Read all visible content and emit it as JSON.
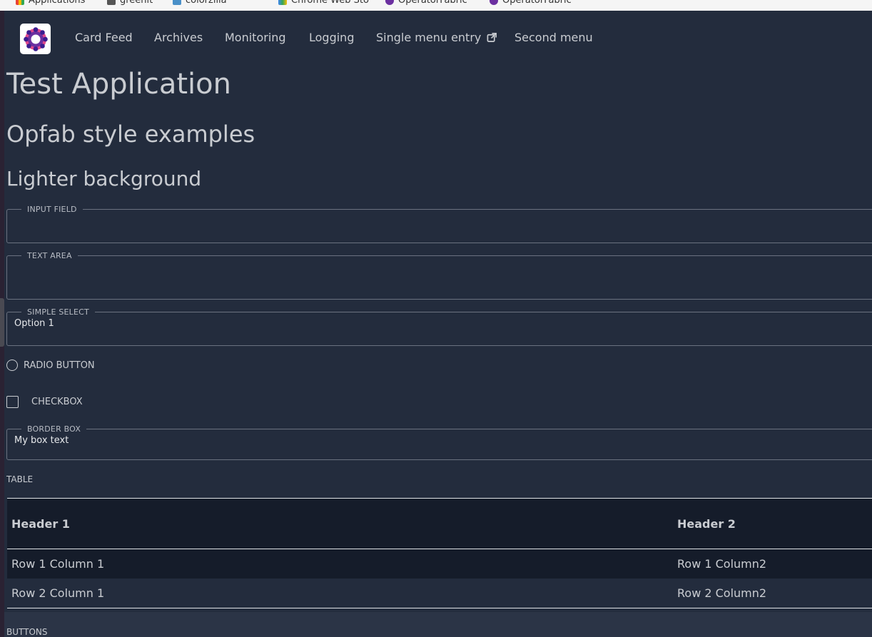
{
  "colors": {
    "background": "#232c3d",
    "table_header_bg": "#151c2a",
    "text": "#c9ccd1",
    "logo_purple": "#6b2fa0"
  },
  "bookmarks_bar": [
    {
      "label": "Applications",
      "icon": "apps-icon"
    },
    {
      "label": "greenit",
      "icon": "folder-icon"
    },
    {
      "label": "colorzilla",
      "icon": "page-icon"
    },
    {
      "label": "Chrome Web Sto",
      "icon": "chrome-store-icon"
    },
    {
      "label": "OperatorFabric",
      "icon": "opfab-favicon"
    },
    {
      "label": "OperatorFabric",
      "icon": "opfab-favicon"
    }
  ],
  "navbar": {
    "logo": "opfab-logo-icon",
    "items": [
      {
        "label": "Card Feed"
      },
      {
        "label": "Archives"
      },
      {
        "label": "Monitoring"
      },
      {
        "label": "Logging"
      },
      {
        "label": "Single menu entry",
        "icon": "external-link-icon"
      },
      {
        "label": "Second menu"
      }
    ]
  },
  "page": {
    "title": "Test Application",
    "subtitle": "Opfab style examples",
    "section": "Lighter background"
  },
  "form": {
    "input_field": {
      "legend": "INPUT FIELD",
      "value": ""
    },
    "text_area": {
      "legend": "TEXT AREA",
      "value": ""
    },
    "simple_select": {
      "legend": "SIMPLE SELECT",
      "selected": "Option 1"
    },
    "radio": {
      "label": "RADIO BUTTON",
      "checked": false
    },
    "checkbox": {
      "label": "CHECKBOX",
      "checked": false
    },
    "border_box": {
      "legend": "BORDER BOX",
      "text": "My box text"
    }
  },
  "table": {
    "label": "TABLE",
    "headers": [
      "Header 1",
      "Header 2"
    ],
    "rows": [
      [
        "Row 1 Column 1",
        "Row 1 Column2"
      ],
      [
        "Row 2 Column 1",
        "Row 2 Column2"
      ]
    ]
  },
  "buttons_label": "BUTTONS"
}
